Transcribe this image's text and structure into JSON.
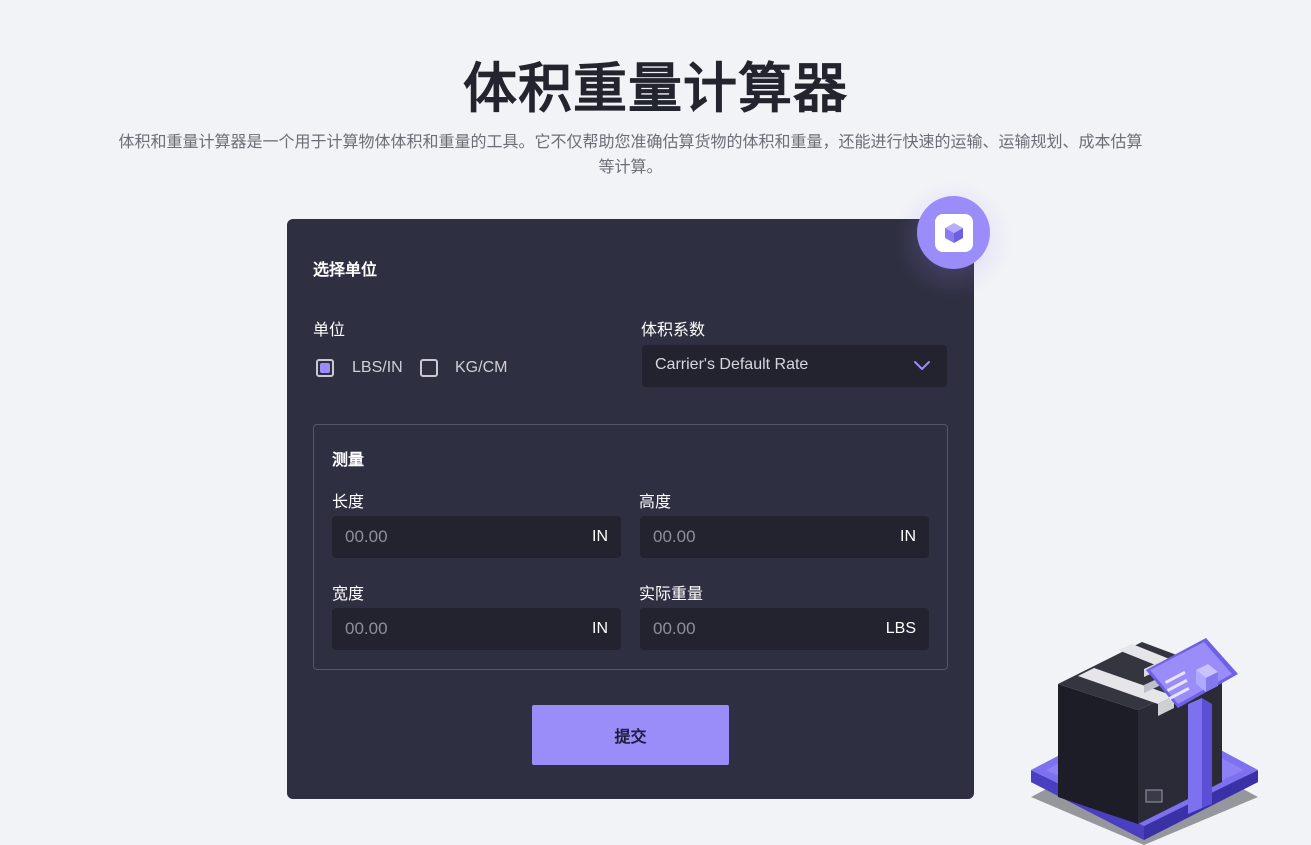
{
  "header": {
    "title": "体积重量计算器",
    "subtitle": "体积和重量计算器是一个用于计算物体体积和重量的工具。它不仅帮助您准确估算货物的体积和重量，还能进行快速的运输、运输规划、成本估算等计算。"
  },
  "form": {
    "section_unit": "选择单位",
    "unit_label": "单位",
    "unit_options": [
      {
        "label": "LBS/IN",
        "checked": true
      },
      {
        "label": "KG/CM",
        "checked": false
      }
    ],
    "factor_label": "体积系数",
    "factor_selected": "Carrier's Default Rate",
    "section_measure": "测量",
    "fields": {
      "length": {
        "label": "长度",
        "placeholder": "00.00",
        "unit": "IN"
      },
      "height": {
        "label": "高度",
        "placeholder": "00.00",
        "unit": "IN"
      },
      "width": {
        "label": "宽度",
        "placeholder": "00.00",
        "unit": "IN"
      },
      "actual_weight": {
        "label": "实际重量",
        "placeholder": "00.00",
        "unit": "LBS"
      }
    },
    "submit_label": "提交"
  },
  "icons": {
    "badge": "cube-icon",
    "select": "chevron-down-icon",
    "illustration": "package-on-scale-illustration"
  },
  "colors": {
    "accent": "#9a8dfa",
    "card_bg": "#2e2f40",
    "input_bg": "#22232f",
    "page_bg": "#f2f3f6"
  }
}
